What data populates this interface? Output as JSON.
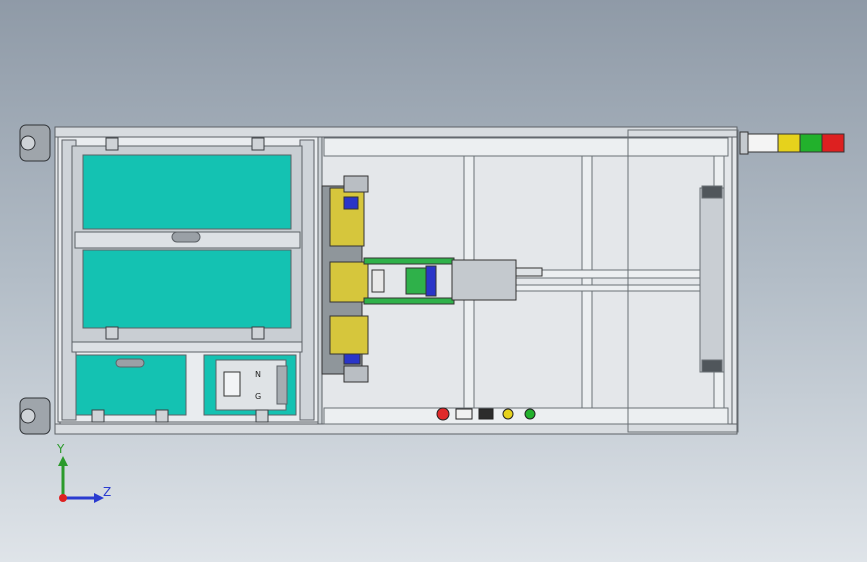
{
  "view": {
    "axes": {
      "y_label": "Y",
      "z_label": "Z"
    },
    "panel_labels": {
      "selector_n": "N",
      "selector_g": "G"
    },
    "colors": {
      "background_top": "#8f9aa7",
      "frame": "#d9dde2",
      "frame_dark": "#6f7479",
      "panel_teal": "#14c2b2",
      "yellow_block": "#d6c63c",
      "green_rod": "#2fb14a",
      "blue_part": "#2a35c8",
      "tower_green": "#22b12c",
      "tower_yellow": "#e6d21c",
      "tower_red": "#dd2020",
      "estop_red": "#e02a2a"
    },
    "icons": [
      "caster-wheel-icon",
      "emergency-stop-icon",
      "indicator-light-icon",
      "axis-triad-icon",
      "signal-tower-icon"
    ]
  }
}
